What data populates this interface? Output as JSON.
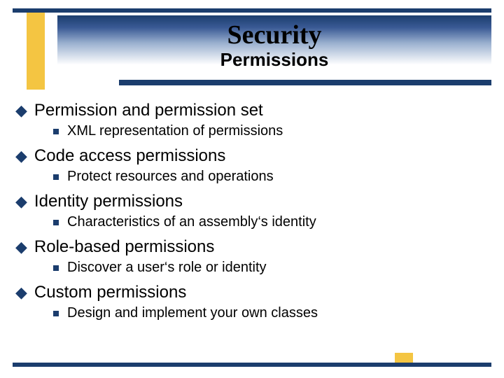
{
  "header": {
    "title": "Security",
    "subtitle": "Permissions"
  },
  "bullets": [
    {
      "text": "Permission and permission set",
      "sub": [
        {
          "text": "XML representation of permissions"
        }
      ]
    },
    {
      "text": "Code access permissions",
      "sub": [
        {
          "text": "Protect resources and operations"
        }
      ]
    },
    {
      "text": "Identity permissions",
      "sub": [
        {
          "text": "Characteristics of an assembly‘s identity"
        }
      ]
    },
    {
      "text": "Role-based permissions",
      "sub": [
        {
          "text": "Discover a user‘s role or identity"
        }
      ]
    },
    {
      "text": "Custom permissions",
      "sub": [
        {
          "text": "Design and implement your own classes"
        }
      ]
    }
  ],
  "colors": {
    "accent": "#1b3d6d",
    "highlight": "#f4c542"
  }
}
